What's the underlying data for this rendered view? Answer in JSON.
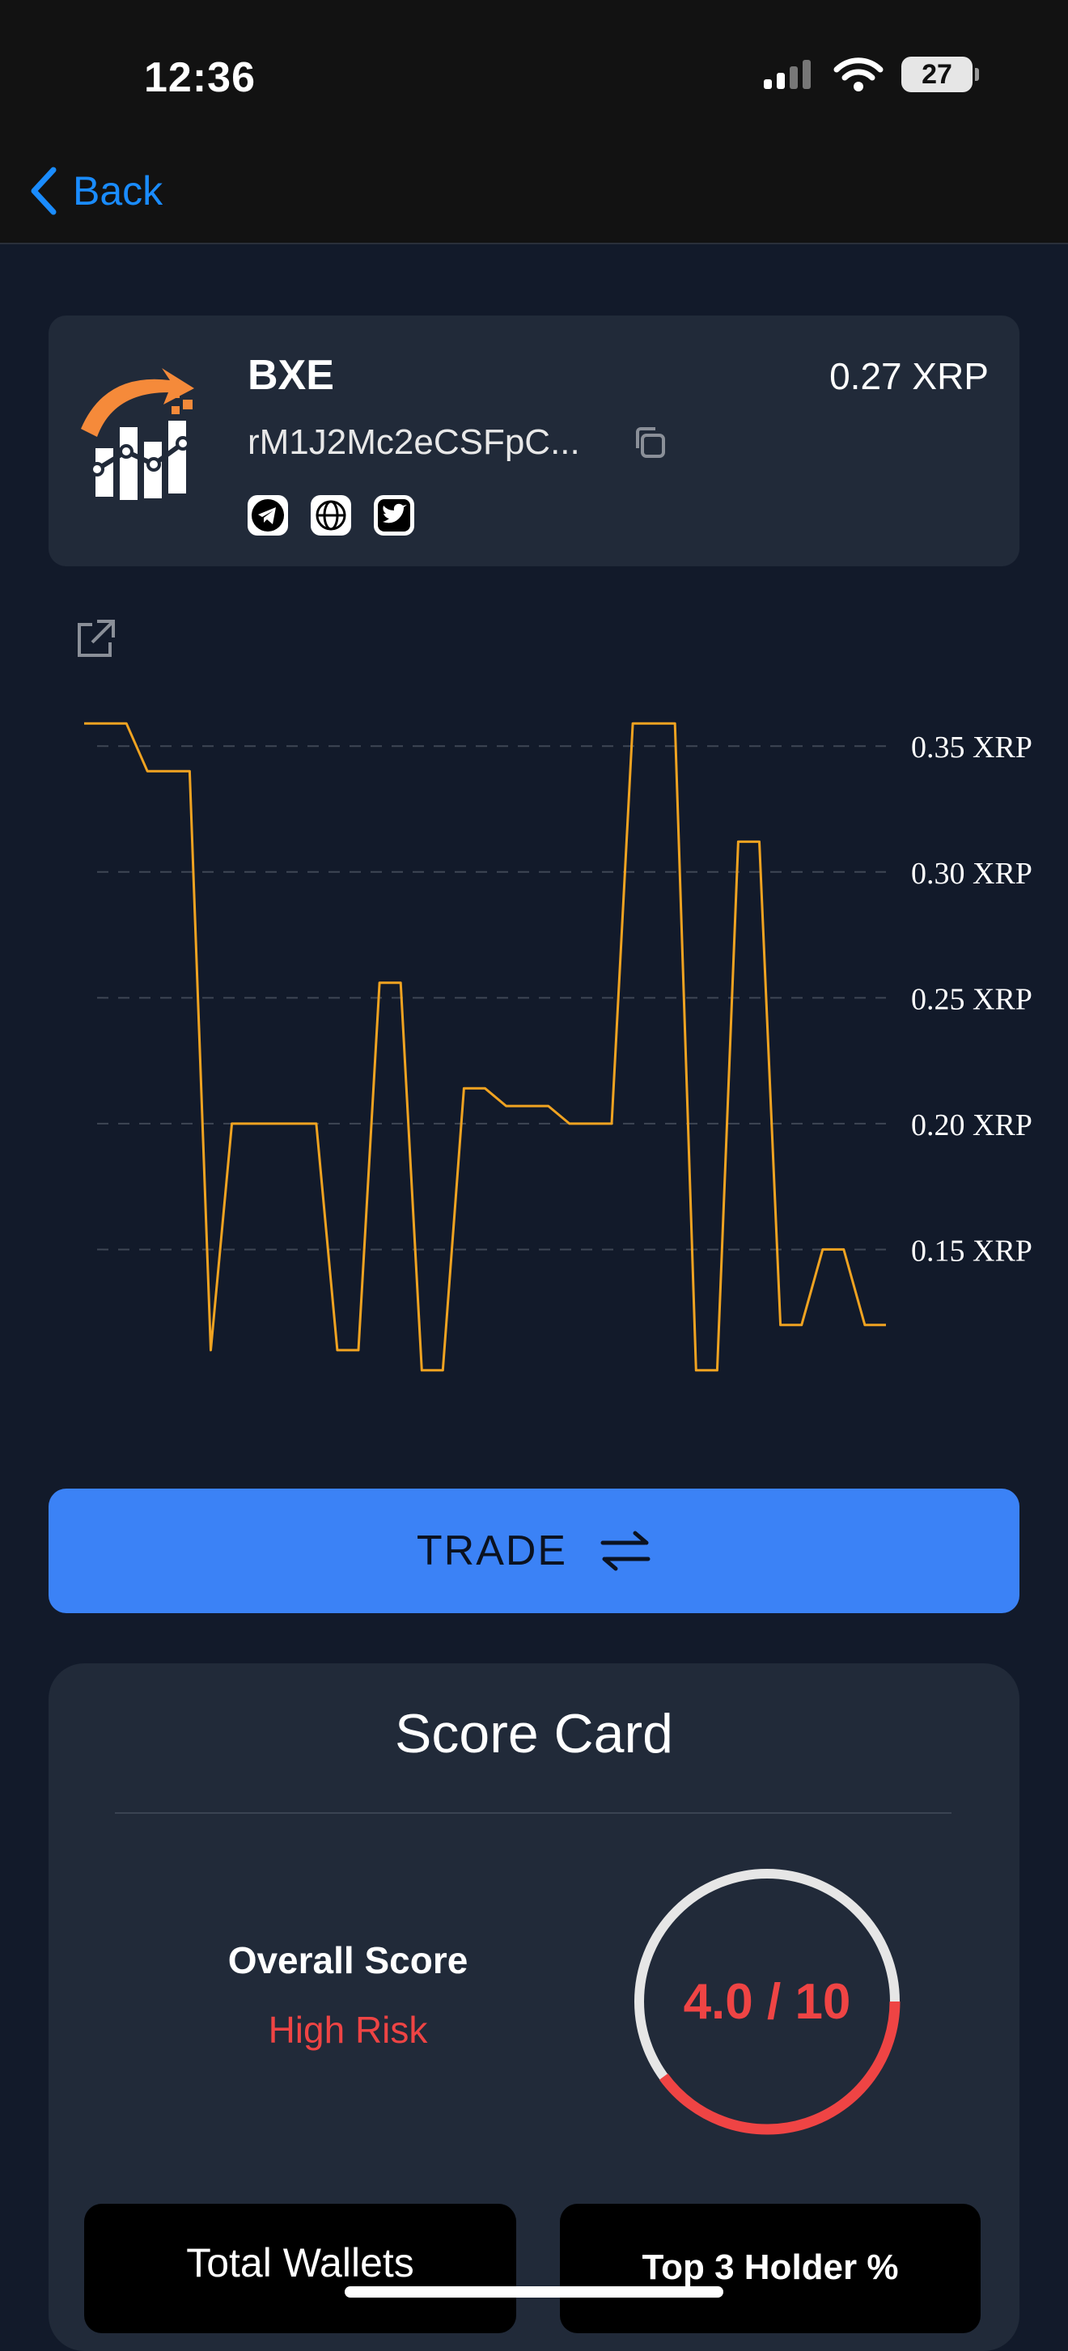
{
  "status_bar": {
    "time": "12:36",
    "battery": "27"
  },
  "nav": {
    "back_label": "Back"
  },
  "token": {
    "name": "BXE",
    "price": "0.27 XRP",
    "address": "rM1J2Mc2eCSFpC...",
    "socials": [
      "telegram-icon",
      "globe-icon",
      "twitter-icon"
    ]
  },
  "chart_data": {
    "type": "line",
    "color": "#f0a321",
    "y_tick_labels": [
      "0.35 XRP",
      "0.30 XRP",
      "0.25 XRP",
      "0.20 XRP",
      "0.15 XRP"
    ],
    "y_ticks": [
      0.35,
      0.3,
      0.25,
      0.2,
      0.15
    ],
    "ylim": [
      0.1,
      0.37
    ],
    "grid": true,
    "values": [
      0.359,
      0.359,
      0.359,
      0.34,
      0.34,
      0.34,
      0.11,
      0.2,
      0.2,
      0.2,
      0.2,
      0.2,
      0.11,
      0.11,
      0.256,
      0.256,
      0.102,
      0.102,
      0.214,
      0.214,
      0.207,
      0.207,
      0.207,
      0.2,
      0.2,
      0.2,
      0.359,
      0.359,
      0.359,
      0.102,
      0.102,
      0.312,
      0.312,
      0.12,
      0.12,
      0.15,
      0.15,
      0.12,
      0.12
    ]
  },
  "trade": {
    "label": "TRADE"
  },
  "score_card": {
    "title": "Score Card",
    "overall_label": "Overall Score",
    "risk_label": "High Risk",
    "score_text": "4.0 / 10",
    "score": 4.0,
    "max": 10,
    "colors": {
      "risk": "#ef4444",
      "track": "#e6e6e6"
    }
  },
  "stats": {
    "total_wallets_label": "Total Wallets",
    "top3_label": "Top 3 Holder %"
  }
}
